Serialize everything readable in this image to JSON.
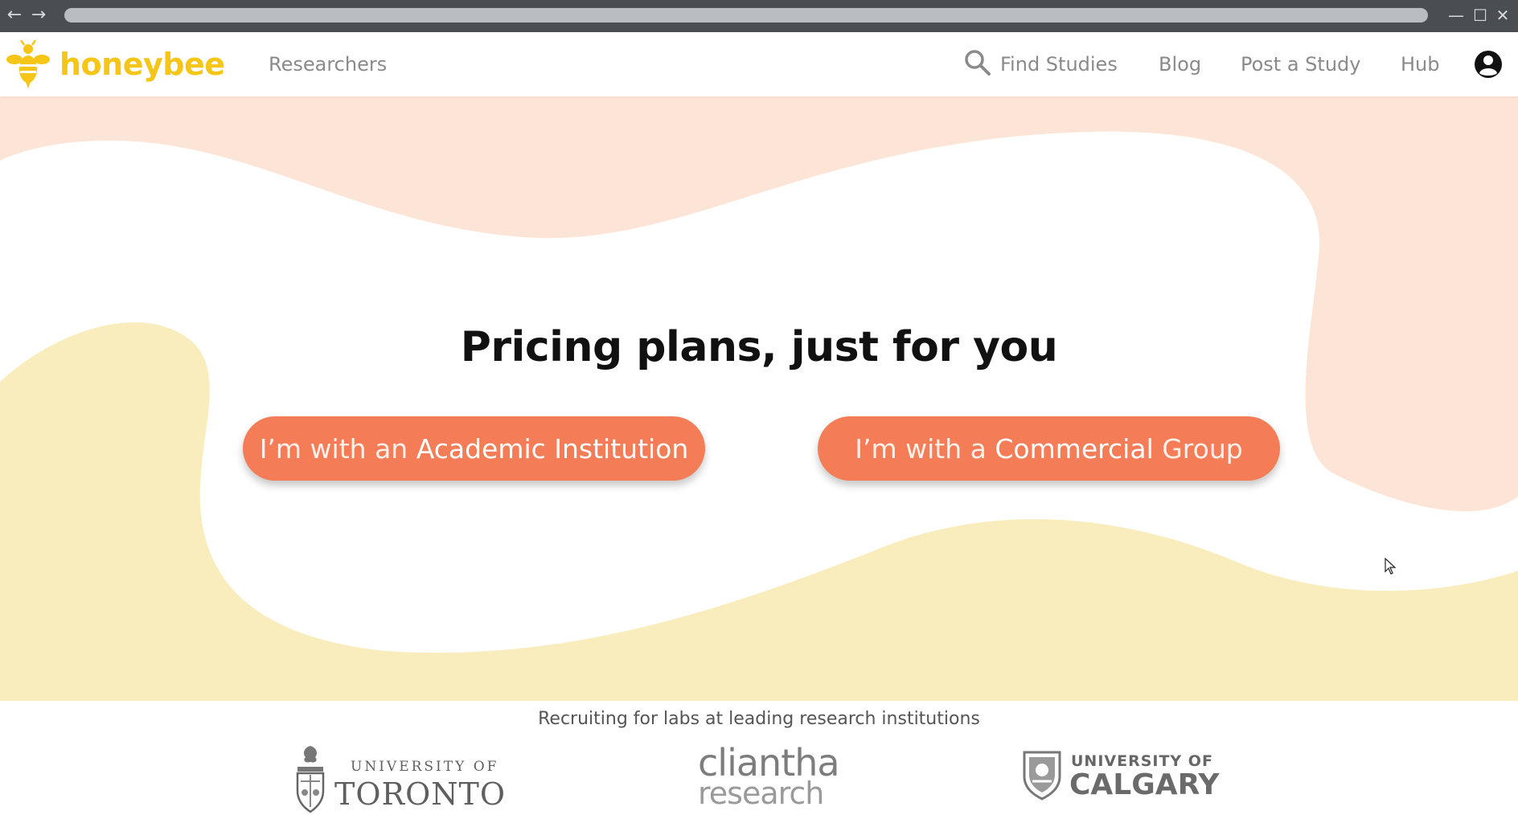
{
  "browser": {
    "back_icon": "arrow-left-icon",
    "forward_icon": "arrow-right-icon",
    "back_glyph": "←",
    "forward_glyph": "→",
    "minimize_glyph": "—",
    "maximize_glyph": "☐",
    "close_glyph": "✕"
  },
  "header": {
    "logo_text": "honeybee",
    "logo_icon": "bee-icon",
    "nav_left": "Researchers",
    "find_studies": "Find Studies",
    "blog": "Blog",
    "post_study": "Post a Study",
    "hub": "Hub",
    "account_icon": "user-circle-icon"
  },
  "hero": {
    "title": "Pricing plans, just for you",
    "academic_prefix": "I’m with an ",
    "academic_strong": "Academic Institution",
    "commercial_prefix": "I’m with a ",
    "commercial_strong": "Commercial",
    "commercial_suffix": " Group"
  },
  "institutions": {
    "caption": "Recruiting for labs at leading research institutions",
    "toronto_line1": "UNIVERSITY OF",
    "toronto_line2": "TORONTO",
    "cliantha_line1": "cliantha",
    "cliantha_line2": "research",
    "calgary_line1": "UNIVERSITY OF",
    "calgary_line2": "CALGARY"
  },
  "colors": {
    "brand_yellow": "#f5c518",
    "cta_orange": "#f47d58",
    "blob_peach": "#fce5d6",
    "blob_yellow": "#faedbd",
    "nav_gray": "#8a8a8a"
  }
}
